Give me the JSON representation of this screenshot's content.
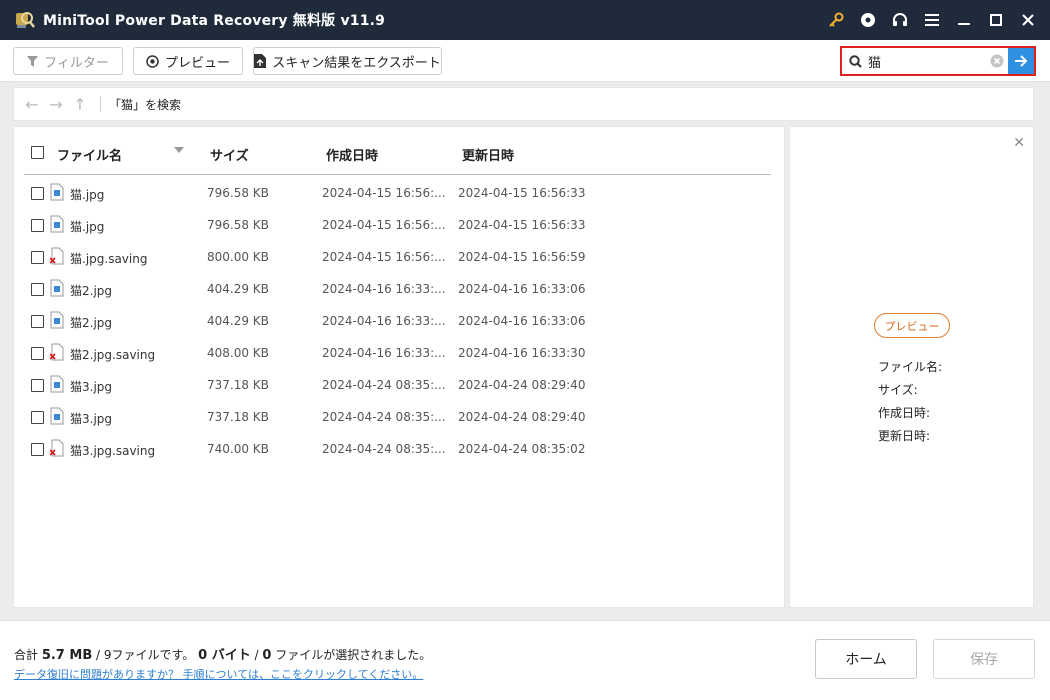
{
  "window": {
    "title": "MiniTool Power Data Recovery 無料版 v11.9",
    "icons": [
      "key-icon",
      "disc-icon",
      "headset-icon",
      "menu-icon",
      "minimize-icon",
      "maximize-icon",
      "close-icon"
    ]
  },
  "toolbar": {
    "filter_label": "フィルター",
    "preview_label": "プレビュー",
    "export_label": "スキャン結果をエクスポート"
  },
  "search": {
    "value": "猫"
  },
  "nav": {
    "path": "「猫」を検索"
  },
  "table": {
    "headers": {
      "name": "ファイル名",
      "size": "サイズ",
      "created": "作成日時",
      "modified": "更新日時"
    },
    "rows": [
      {
        "name": "猫.jpg",
        "size": "796.58 KB",
        "created": "2024-04-15 16:56:...",
        "modified": "2024-04-15 16:56:33",
        "status": "normal"
      },
      {
        "name": "猫.jpg",
        "size": "796.58 KB",
        "created": "2024-04-15 16:56:...",
        "modified": "2024-04-15 16:56:33",
        "status": "normal"
      },
      {
        "name": "猫.jpg.saving",
        "size": "800.00 KB",
        "created": "2024-04-15 16:56:...",
        "modified": "2024-04-15 16:56:59",
        "status": "deleted"
      },
      {
        "name": "猫2.jpg",
        "size": "404.29 KB",
        "created": "2024-04-16 16:33:...",
        "modified": "2024-04-16 16:33:06",
        "status": "normal"
      },
      {
        "name": "猫2.jpg",
        "size": "404.29 KB",
        "created": "2024-04-16 16:33:...",
        "modified": "2024-04-16 16:33:06",
        "status": "normal"
      },
      {
        "name": "猫2.jpg.saving",
        "size": "408.00 KB",
        "created": "2024-04-16 16:33:...",
        "modified": "2024-04-16 16:33:30",
        "status": "deleted"
      },
      {
        "name": "猫3.jpg",
        "size": "737.18 KB",
        "created": "2024-04-24 08:35:...",
        "modified": "2024-04-24 08:29:40",
        "status": "normal"
      },
      {
        "name": "猫3.jpg",
        "size": "737.18 KB",
        "created": "2024-04-24 08:35:...",
        "modified": "2024-04-24 08:29:40",
        "status": "normal"
      },
      {
        "name": "猫3.jpg.saving",
        "size": "740.00 KB",
        "created": "2024-04-24 08:35:...",
        "modified": "2024-04-24 08:35:02",
        "status": "deleted"
      }
    ]
  },
  "preview": {
    "button_label": "プレビュー",
    "filename_label": "ファイル名:",
    "size_label": "サイズ:",
    "created_label": "作成日時:",
    "modified_label": "更新日時:"
  },
  "footer": {
    "summary_prefix": "合計 ",
    "summary_total": "5.7 MB",
    "summary_mid1": " / 9ファイルです。 ",
    "summary_bytes": "0 バイト",
    "summary_mid2": " / ",
    "summary_count": "0",
    "summary_suffix": " ファイルが選択されました。",
    "help_link": "データ復旧に問題がありますか？ 手順については、ここをクリックしてください。",
    "home_label": "ホーム",
    "save_label": "保存"
  },
  "colors": {
    "titlebar": "#1f2b3a",
    "accent_blue": "#2f8fe0",
    "search_border": "#e02020",
    "preview_orange": "#e07b2a"
  }
}
